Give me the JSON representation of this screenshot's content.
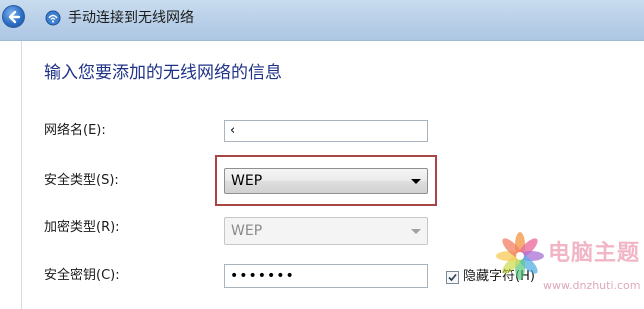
{
  "window": {
    "title": "手动连接到无线网络"
  },
  "form": {
    "heading": "输入您要添加的无线网络的信息",
    "network_name": {
      "label": "网络名(E):",
      "value": "‹"
    },
    "security_type": {
      "label": "安全类型(S):",
      "value": "WEP"
    },
    "encryption_type": {
      "label": "加密类型(R):",
      "value": "WEP"
    },
    "security_key": {
      "label": "安全密钥(C):",
      "value": "•••••••"
    },
    "hide_chars": {
      "label": "隐藏字符(H)",
      "checked": true
    }
  },
  "watermark": {
    "brand": "电脑主题",
    "url": "www.dnzhuti.com"
  },
  "colors": {
    "heading": "#1e3287",
    "highlight": "#a64647",
    "titlebar": "#c9dcef"
  },
  "icons": [
    "back-arrow-icon",
    "wireless-network-icon",
    "dropdown-arrow-icon",
    "checkmark-icon",
    "flower-logo-icon"
  ]
}
